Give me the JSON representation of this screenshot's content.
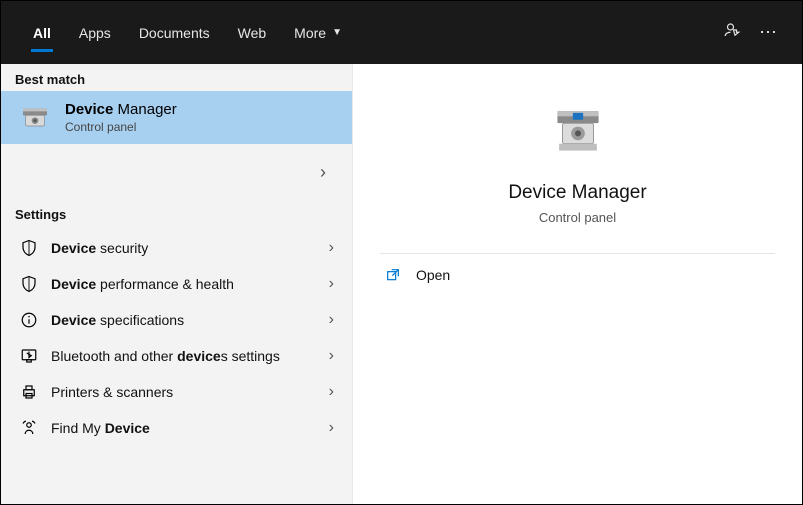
{
  "header": {
    "tabs": [
      {
        "label": "All",
        "active": true
      },
      {
        "label": "Apps",
        "active": false
      },
      {
        "label": "Documents",
        "active": false
      },
      {
        "label": "Web",
        "active": false
      },
      {
        "label": "More",
        "active": false,
        "dropdown": true
      }
    ]
  },
  "left": {
    "best_match_label": "Best match",
    "best_match": {
      "title_bold": "Device",
      "title_rest": " Manager",
      "subtitle": "Control panel"
    },
    "settings_label": "Settings",
    "settings": [
      {
        "icon": "shield-icon",
        "pre": "",
        "bold": "Device",
        "post": " security"
      },
      {
        "icon": "shield-icon",
        "pre": "",
        "bold": "Device",
        "post": " performance & health"
      },
      {
        "icon": "info-icon",
        "pre": "",
        "bold": "Device",
        "post": " specifications"
      },
      {
        "icon": "bluetooth-icon",
        "pre": "Bluetooth and other ",
        "bold": "device",
        "post": "s settings"
      },
      {
        "icon": "printer-icon",
        "pre": "Printers & scanners",
        "bold": "",
        "post": ""
      },
      {
        "icon": "findmy-icon",
        "pre": "Find My ",
        "bold": "Device",
        "post": ""
      }
    ]
  },
  "right": {
    "title": "Device Manager",
    "subtitle": "Control panel",
    "actions": [
      {
        "icon": "open-icon",
        "label": "Open"
      }
    ]
  }
}
